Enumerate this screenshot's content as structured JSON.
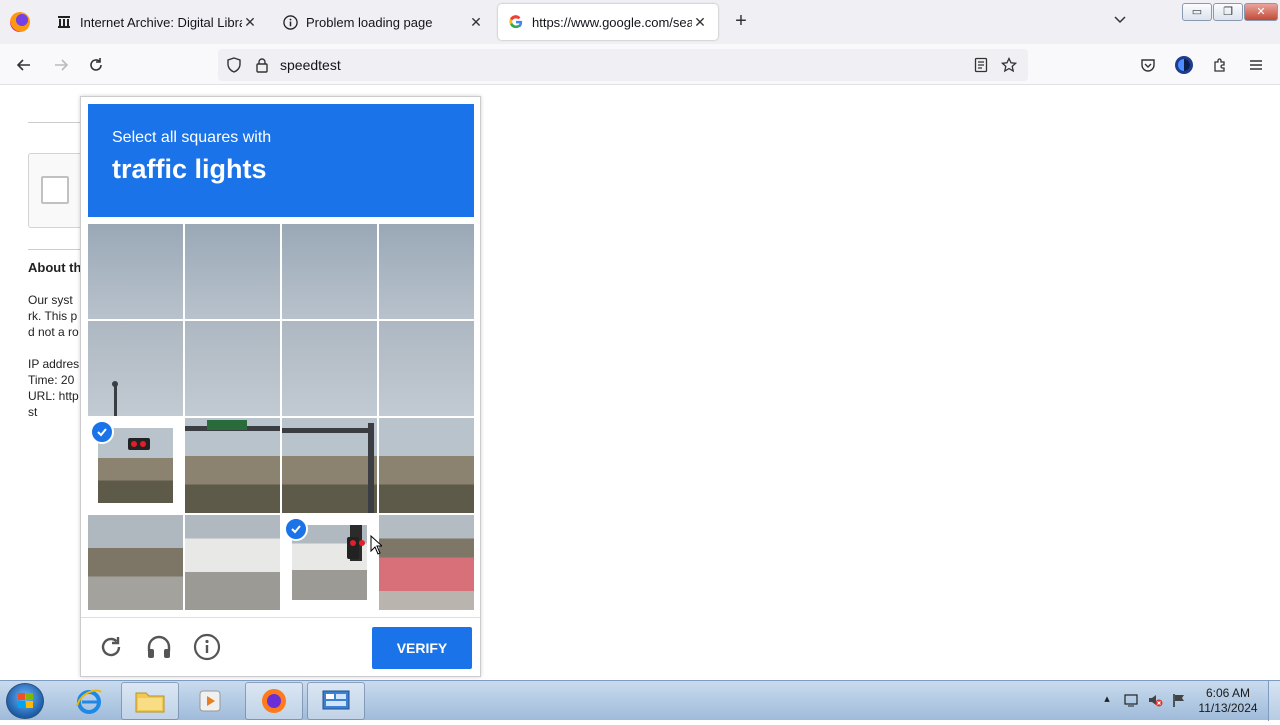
{
  "browser": {
    "tabs": [
      {
        "title": "Internet Archive: Digital Library",
        "icon": "archive-icon",
        "active": false
      },
      {
        "title": "Problem loading page",
        "icon": "info-icon",
        "active": false
      },
      {
        "title": "https://www.google.com/search",
        "icon": "google-icon",
        "active": true
      }
    ],
    "address": "speedtest"
  },
  "page": {
    "about_heading": "About th",
    "para1": [
      "Our syst",
      "rk. This p",
      "d not a ro"
    ],
    "para2": [
      "IP addres",
      "Time: 20",
      "URL: http",
      "st"
    ]
  },
  "captcha": {
    "instruction": "Select all squares with",
    "target": "traffic lights",
    "verify_label": "VERIFY",
    "selected_tiles": [
      8,
      14
    ],
    "accent": "#1a73e8"
  },
  "taskbar": {
    "time": "6:06 AM",
    "date": "11/13/2024"
  }
}
